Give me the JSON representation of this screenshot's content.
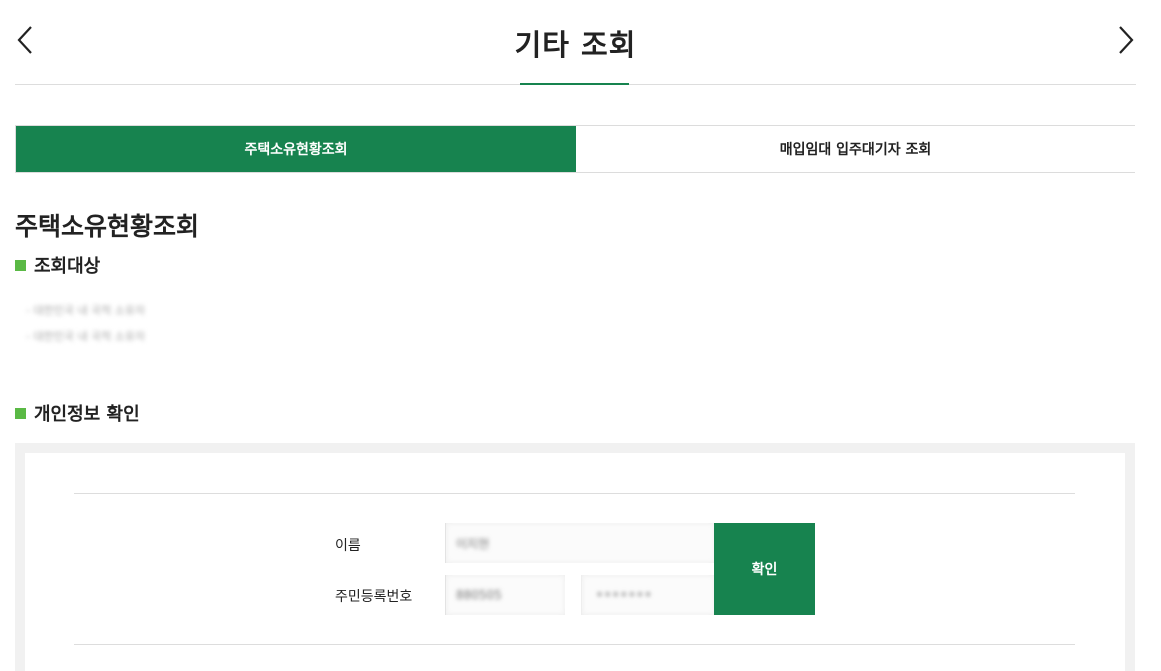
{
  "header": {
    "title": "기타 조회",
    "prev_icon": "chevron-left-icon",
    "next_icon": "chevron-right-icon"
  },
  "tabs": [
    {
      "label": "주택소유현황조회",
      "active": true
    },
    {
      "label": "매입임대 입주대기자 조회",
      "active": false
    }
  ],
  "section": {
    "title": "주택소유현황조회"
  },
  "target": {
    "heading": "조회대상",
    "items": [
      "- 대한민국 내 국적 소유자",
      "- 대한민국 내 국적 소유자"
    ]
  },
  "personal_info": {
    "heading": "개인정보 확인",
    "name_label": "이름",
    "name_value": "이지현",
    "rrn_label": "주민등록번호",
    "rrn_front": "880505",
    "rrn_back": "•••••••",
    "confirm_label": "확인"
  },
  "colors": {
    "brand_green": "#17834f",
    "bullet_green": "#5ab945",
    "panel_bg": "#f1f1f1"
  }
}
